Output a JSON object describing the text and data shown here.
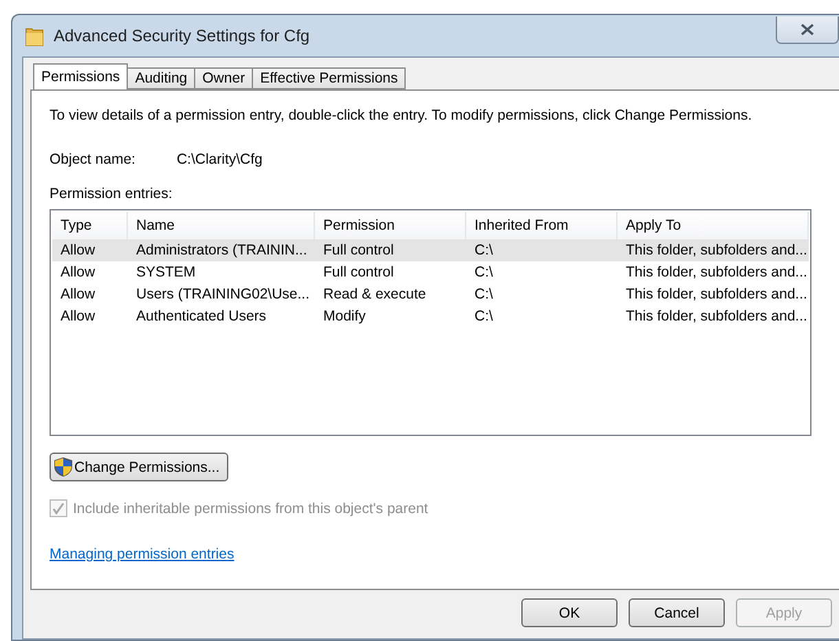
{
  "window": {
    "title": "Advanced Security Settings for Cfg"
  },
  "tabs": [
    {
      "label": "Permissions",
      "selected": true
    },
    {
      "label": "Auditing",
      "selected": false
    },
    {
      "label": "Owner",
      "selected": false
    },
    {
      "label": "Effective Permissions",
      "selected": false
    }
  ],
  "instructions": "To view details of a permission entry, double-click the entry. To modify permissions, click Change Permissions.",
  "object_name": {
    "label": "Object name:",
    "value": "C:\\Clarity\\Cfg"
  },
  "entries_label": "Permission entries:",
  "table": {
    "columns": [
      "Type",
      "Name",
      "Permission",
      "Inherited From",
      "Apply To"
    ],
    "rows": [
      {
        "cells": [
          "Allow",
          "Administrators (TRAININ...",
          "Full control",
          "C:\\",
          "This folder, subfolders and..."
        ],
        "selected": true
      },
      {
        "cells": [
          "Allow",
          "SYSTEM",
          "Full control",
          "C:\\",
          "This folder, subfolders and..."
        ],
        "selected": false
      },
      {
        "cells": [
          "Allow",
          "Users (TRAINING02\\Use...",
          "Read & execute",
          "C:\\",
          "This folder, subfolders and..."
        ],
        "selected": false
      },
      {
        "cells": [
          "Allow",
          "Authenticated Users",
          "Modify",
          "C:\\",
          "This folder, subfolders and..."
        ],
        "selected": false
      }
    ]
  },
  "change_button": "Change Permissions...",
  "inherit": {
    "label": "Include inheritable permissions from this object's parent",
    "checked": true,
    "disabled": true
  },
  "link": "Managing permission entries",
  "buttons": [
    {
      "label": "OK",
      "disabled": false
    },
    {
      "label": "Cancel",
      "disabled": false
    },
    {
      "label": "Apply",
      "disabled": true
    }
  ]
}
